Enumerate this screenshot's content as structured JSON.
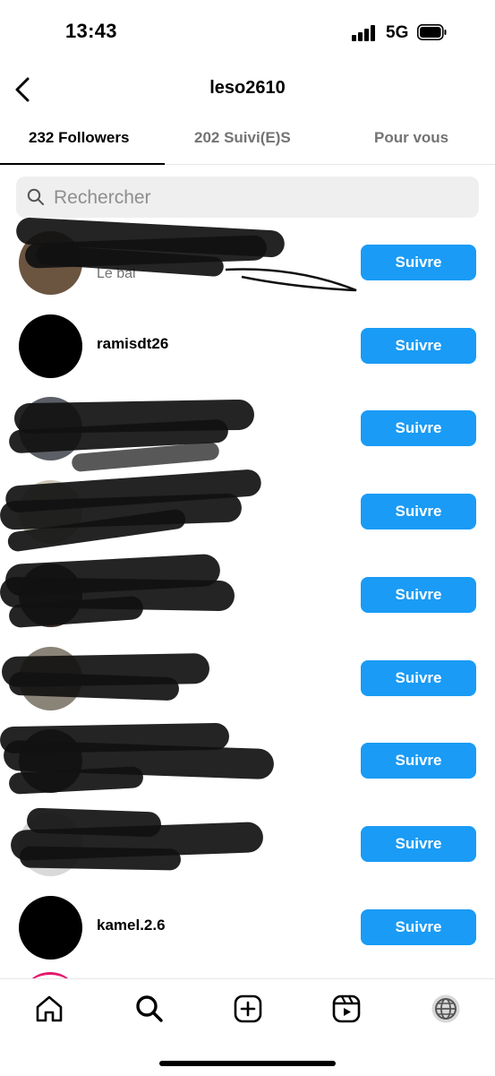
{
  "status_bar": {
    "time": "13:43",
    "network": "5G"
  },
  "header": {
    "title": "leso2610",
    "back_icon": "chevron-left-icon"
  },
  "tabs": [
    {
      "label": "232 Followers",
      "active": true
    },
    {
      "label": "202 Suivi(E)S",
      "active": false
    },
    {
      "label": "Pour vous",
      "active": false
    }
  ],
  "search": {
    "placeholder": "Rechercher",
    "value": ""
  },
  "followers": [
    {
      "username": "",
      "subname": "Le bal",
      "redacted": true
    },
    {
      "username": "ramisdt26",
      "subname": "",
      "redacted": false
    },
    {
      "username": "",
      "subname": "",
      "redacted": true
    },
    {
      "username": "",
      "subname": "",
      "redacted": true
    },
    {
      "username": "",
      "subname": "",
      "redacted": true
    },
    {
      "username": "",
      "subname": "",
      "redacted": true
    },
    {
      "username": "",
      "subname": "",
      "redacted": true
    },
    {
      "username": "",
      "subname": "",
      "redacted": true
    },
    {
      "username": "kamel.2.6",
      "subname": "",
      "redacted": false
    }
  ],
  "follow_button_label": "Suivre",
  "colors": {
    "accent": "#1a9bf5",
    "muted_text": "#737373",
    "search_bg": "#efefef",
    "story_ring": "#e4186e"
  },
  "bottom_nav": [
    {
      "icon": "home-icon"
    },
    {
      "icon": "search-icon"
    },
    {
      "icon": "create-post-icon"
    },
    {
      "icon": "reels-icon"
    },
    {
      "icon": "profile-avatar-icon"
    }
  ]
}
